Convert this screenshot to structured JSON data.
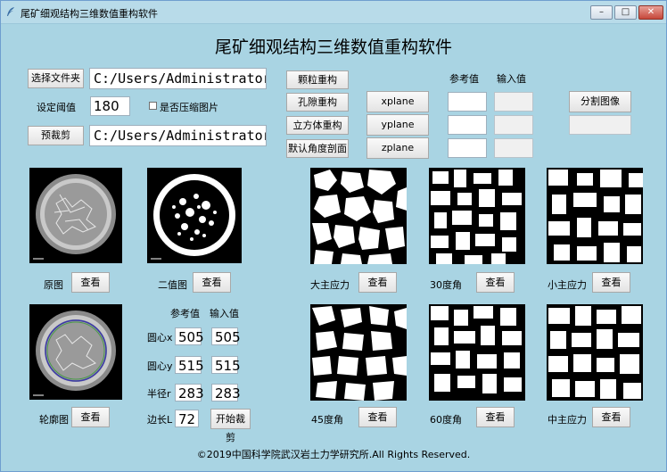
{
  "window": {
    "title": "尾矿细观结构三维数值重构软件",
    "controls": {
      "minimize": "–",
      "maximize": "□",
      "close": "✕"
    }
  },
  "app": {
    "heading": "尾矿细观结构三维数值重构软件",
    "footer": "©2019中国科学院武汉岩土力学研究所.All Rights Reserved."
  },
  "file": {
    "select_folder_label": "选择文件夹",
    "folder_path": "C:/Users/Administrator.QH-",
    "threshold_label": "设定阈值",
    "threshold_value": "180",
    "compress_label": "是否压缩图片",
    "precrop_label": "预裁剪",
    "precrop_path": "C:/Users/Administrator.QH-"
  },
  "reconstruct": {
    "particle": "颗粒重构",
    "pore": "孔隙重构",
    "cube": "立方体重构",
    "default_angle": "默认角度剖面"
  },
  "planes": {
    "ref_header": "参考值",
    "input_header": "输入值",
    "xplane": "xplane",
    "yplane": "yplane",
    "zplane": "zplane"
  },
  "split_image_label": "分割图像",
  "preview": {
    "original_label": "原图",
    "binary_label": "二值图",
    "contour_label": "轮廓图",
    "view_label": "查看"
  },
  "crop": {
    "ref_header": "参考值",
    "input_header": "输入值",
    "cx_label": "圆心x",
    "cx_ref": "505",
    "cx_input": "505",
    "cy_label": "圆心y",
    "cy_ref": "515",
    "cy_input": "515",
    "r_label": "半径r",
    "r_ref": "283",
    "r_input": "283",
    "side_label": "边长L",
    "side_value": "72",
    "start_crop": "开始裁剪"
  },
  "sections": {
    "major": "大主应力",
    "deg30": "30度角",
    "minor": "小主应力",
    "deg45": "45度角",
    "deg60": "60度角",
    "middle": "中主应力",
    "view_label": "查看"
  },
  "colors": {
    "window_bg": "#a9d4e3",
    "titlebar_bg": "#b8dbe9"
  }
}
